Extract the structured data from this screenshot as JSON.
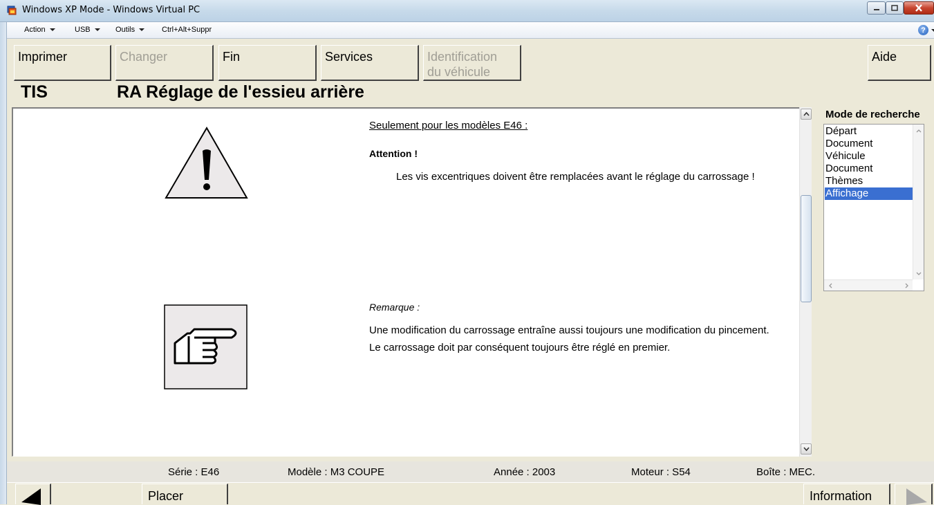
{
  "window": {
    "title": "Windows XP Mode - Windows Virtual PC"
  },
  "menubar": {
    "items": [
      {
        "label": "Action"
      },
      {
        "label": "USB"
      },
      {
        "label": "Outils"
      },
      {
        "label": "Ctrl+Alt+Suppr"
      }
    ],
    "help_icon": "help-icon"
  },
  "toolbar": {
    "print": "Imprimer",
    "change": "Changer",
    "end": "Fin",
    "services": "Services",
    "vehicle_id_line1": "Identification",
    "vehicle_id_line2": "du véhicule",
    "help": "Aide"
  },
  "header": {
    "app": "TIS",
    "title": "RA  Réglage de l'essieu arrière"
  },
  "content": {
    "models_note": "Seulement pour les modèles E46 :",
    "attention": "Attention !",
    "warning_text": "Les vis excentriques doivent être remplacées avant le réglage du carrossage !",
    "remark_label": "Remarque :",
    "remark_line1": "Une modification du carrossage entraîne aussi toujours une modification du pincement.",
    "remark_line2": "Le carrossage doit par conséquent toujours être réglé en premier.",
    "icons": [
      "warning-triangle-icon",
      "pointing-hand-icon"
    ]
  },
  "search": {
    "label": "Mode de recherche",
    "items": [
      {
        "label": "Départ",
        "selected": false
      },
      {
        "label": "Document",
        "selected": false
      },
      {
        "label": "Véhicule",
        "selected": false
      },
      {
        "label": "Document",
        "selected": false
      },
      {
        "label": "Thèmes",
        "selected": false
      },
      {
        "label": "Affichage",
        "selected": true
      }
    ],
    "selected_color": "#3a6fd1"
  },
  "status": {
    "series": "Série : E46",
    "model": "Modèle : M3 COUPE",
    "year": "Année : 2003",
    "engine": "Moteur : S54",
    "gearbox": "Boîte : MEC."
  },
  "bottom": {
    "place": "Placer",
    "information": "Information"
  }
}
